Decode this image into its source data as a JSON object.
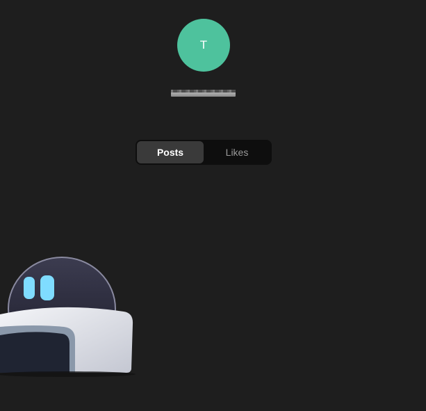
{
  "profile": {
    "avatar_initial": "T",
    "avatar_color": "#4ec29d",
    "username": "testuser"
  },
  "tabs": [
    {
      "label": "Posts",
      "selected": true
    },
    {
      "label": "Likes",
      "selected": false
    }
  ],
  "illustration": {
    "icon": "robot-mascot-icon"
  }
}
